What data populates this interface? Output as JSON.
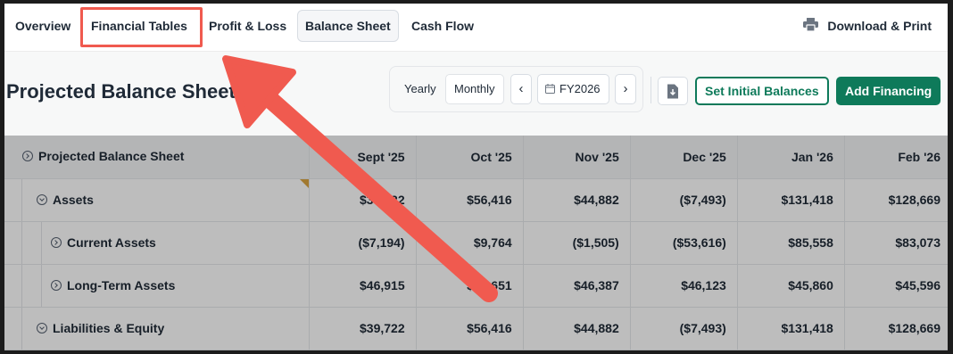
{
  "nav": {
    "tabs": [
      {
        "label": "Overview"
      },
      {
        "label": "Financial Tables"
      },
      {
        "label": "Profit & Loss"
      },
      {
        "label": "Balance Sheet"
      },
      {
        "label": "Cash Flow"
      }
    ],
    "active_tab": "Balance Sheet",
    "highlighted_tab": "Financial Tables",
    "download_label": "Download & Print"
  },
  "toolbar": {
    "page_title": "Projected Balance Sheet",
    "period_options": [
      "Yearly",
      "Monthly"
    ],
    "selected_period": "Monthly",
    "fiscal_year": "FY2026",
    "set_balances_label": "Set Initial Balances",
    "add_financing_label": "Add Financing"
  },
  "colors": {
    "brand_green": "#0e7a5a",
    "annotation_red": "#f05a4f"
  },
  "icons": [
    "printer-icon",
    "chevron-left-icon",
    "chevron-right-icon",
    "calendar-icon",
    "download-file-icon",
    "expand-circle-icon",
    "collapse-circle-icon"
  ],
  "table": {
    "header_label": "Projected Balance Sheet",
    "columns": [
      "Sept '25",
      "Oct '25",
      "Nov '25",
      "Dec '25",
      "Jan '26",
      "Feb '26"
    ],
    "rows": [
      {
        "label": "Assets",
        "values": [
          "$39,722",
          "$56,416",
          "$44,882",
          "($7,493)",
          "$131,418",
          "$128,669"
        ]
      },
      {
        "label": "Current Assets",
        "values": [
          "($7,194)",
          "$9,764",
          "($1,505)",
          "($53,616)",
          "$85,558",
          "$83,073"
        ]
      },
      {
        "label": "Long-Term Assets",
        "values": [
          "$46,915",
          "$46,651",
          "$46,387",
          "$46,123",
          "$45,860",
          "$45,596"
        ]
      },
      {
        "label": "Liabilities & Equity",
        "values": [
          "$39,722",
          "$56,416",
          "$44,882",
          "($7,493)",
          "$131,418",
          "$128,669"
        ]
      }
    ]
  }
}
